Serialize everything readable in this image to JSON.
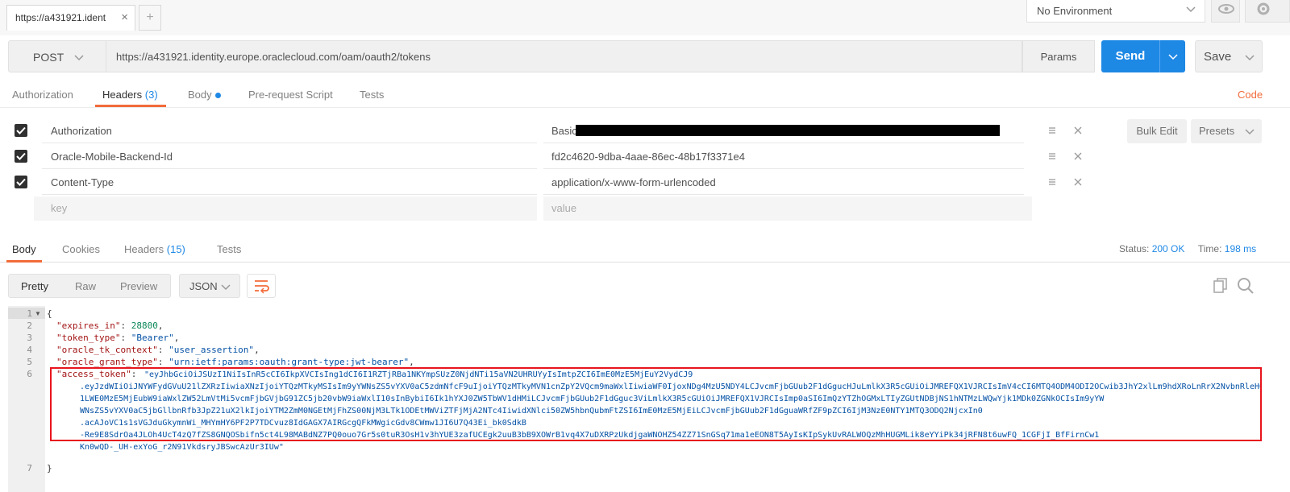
{
  "tab": {
    "title": "https://a431921.ident",
    "close": "×",
    "add": "+"
  },
  "environment": {
    "label": "No Environment"
  },
  "request": {
    "method": "POST",
    "url": "https://a431921.identity.europe.oraclecloud.com/oam/oauth2/tokens",
    "params_label": "Params",
    "send_label": "Send",
    "save_label": "Save"
  },
  "request_tabs": {
    "authorization": "Authorization",
    "headers": "Headers",
    "headers_count": "(3)",
    "body": "Body",
    "prerequest": "Pre-request Script",
    "tests": "Tests",
    "code": "Code"
  },
  "headers": [
    {
      "key": "Authorization",
      "value": "Basic"
    },
    {
      "key": "Oracle-Mobile-Backend-Id",
      "value": "fd2c4620-9dba-4aae-86ec-48b17f3371e4"
    },
    {
      "key": "Content-Type",
      "value": "application/x-www-form-urlencoded"
    }
  ],
  "header_placeholder": {
    "key": "key",
    "value": "value"
  },
  "bulk_edit": "Bulk Edit",
  "presets": "Presets",
  "response_tabs": {
    "body": "Body",
    "cookies": "Cookies",
    "headers": "Headers",
    "headers_count": "(15)",
    "tests": "Tests"
  },
  "status": {
    "label": "Status:",
    "value": "200 OK",
    "time_label": "Time:",
    "time_value": "198 ms"
  },
  "view_modes": {
    "pretty": "Pretty",
    "raw": "Raw",
    "preview": "Preview",
    "format": "JSON"
  },
  "line_numbers": [
    "1",
    "2",
    "3",
    "4",
    "5",
    "6",
    "7"
  ],
  "code": {
    "open": "{",
    "close": "}",
    "expires_in_key": "\"expires_in\"",
    "expires_in_val": "28800",
    "token_type_key": "\"token_type\"",
    "token_type_val": "\"Bearer\"",
    "context_key": "\"oracle_tk_context\"",
    "context_val": "\"user_assertion\"",
    "grant_key": "\"oracle_grant_type\"",
    "grant_val": "\"urn:ietf:params:oauth:grant-type:jwt-bearer\"",
    "access_key": "\"access_token\"",
    "access_lines": [
      "\"eyJhbGciOiJSUzI1NiIsInR5cCI6IkpXVCIsIng1dCI6I1RZTjRBa1NKYmpSUzZ0NjdNTi15aVN2UHRUYyIsImtpZCI6ImE0MzE5MjEuY2VydCJ9",
      ".eyJzdWIiOiJNYWFydGVuU21lZXRzIiwiaXNzIjoiYTQzMTkyMSIsIm9yYWNsZS5vYXV0aC5zdmNfcF9uIjoiYTQzMTkyMVN1cnZpY2VQcm9maWxlIiwiaWF0IjoxNDg4MzU5NDY4LCJvcmFjbGUub2F1dGgucHJuLmlkX3R5cGUiOiJMREFQX1VJRCIsImV4cCI6MTQ4ODM4ODI2OCwib3JhY2xlLm9hdXRoLnRrX2NvbnRleHQiOiJ1c2VyX2Fzc2VydGlvbiIsImF1ZCI6WyJodHRwOi8vbmwxejE0LW1vYmlsZS1tb2JnbnYzMDYtY29yZTEub3BjbW9iaWxlLnoxNC5ubGRjMS5vcmFjbGVjbG91ZC5jb20vaW50ZXJuYWwtcnQiLCJodHRwczovL21jc3Rhbm",
      "1LWE0MzE5MjEubW9iaWxlZW52LmVtMi5vcmFjbGVjbG91ZC5jb20vbW9iaWxlI10sInBybiI6Ik1hYXJ0ZW5TbWV1dHMiLCJvcmFjbGUub2F1dGguc3ViLmlkX3R5cGUiOiJMREFQX1VJRCIsImp0aSI6ImQzYTZhOGMxLTIyZGUtNDBjNS1hNTMzLWQwYjk1MDk0ZGNkOCIsIm9yYW",
      "WNsZS5vYXV0aC5jbGllbnRfb3JpZ21uX2lkIjoiYTM2ZmM0NGEtMjFhZS00NjM3LTk1ODEtMWViZTFjMjA2NTc4IiwidXNlci50ZW5hbnQubmFtZSI6ImE0MzE5MjEiLCJvcmFjbGUub2F1dGguaWRfZF9pZCI6IjM3NzE0NTY1MTQ3ODQ2NjcxIn0",
      ".acAJoVC1s1sVGJduGkymnWi_MHYmHY6PF2P7TDCvuz8IdGAGX7AIRGcgQFkMWgicGdv8CWmw1JI6U7Q43Ei_bk0SdkB",
      "-Re9E8SdrOa4JLOh4UcT4zQ7fZS8GNQOSbifn5ct4L98MABdNZ7PQ0ouo7Gr5s0tuR3OsH1v3hYUE3zafUCEgk2uuB3bB9XOWrB1vq4X7uDXRPzUkdjgaWNOHZ54ZZ71SnGSq71ma1eEON8T5AyIsKIpSykUvRALWOQzMhHUGMLik8eYYiPk34jRFN8t6uwFQ_1CGFjI_BfFirnCw1",
      "Kn0wQD-_UH-exYoG_r2N91VkdsryJBSwcAzUr3IUw\""
    ]
  },
  "colors": {
    "accent": "#f26b3a",
    "send": "#1e88e5",
    "highlight": "#e8141c"
  }
}
